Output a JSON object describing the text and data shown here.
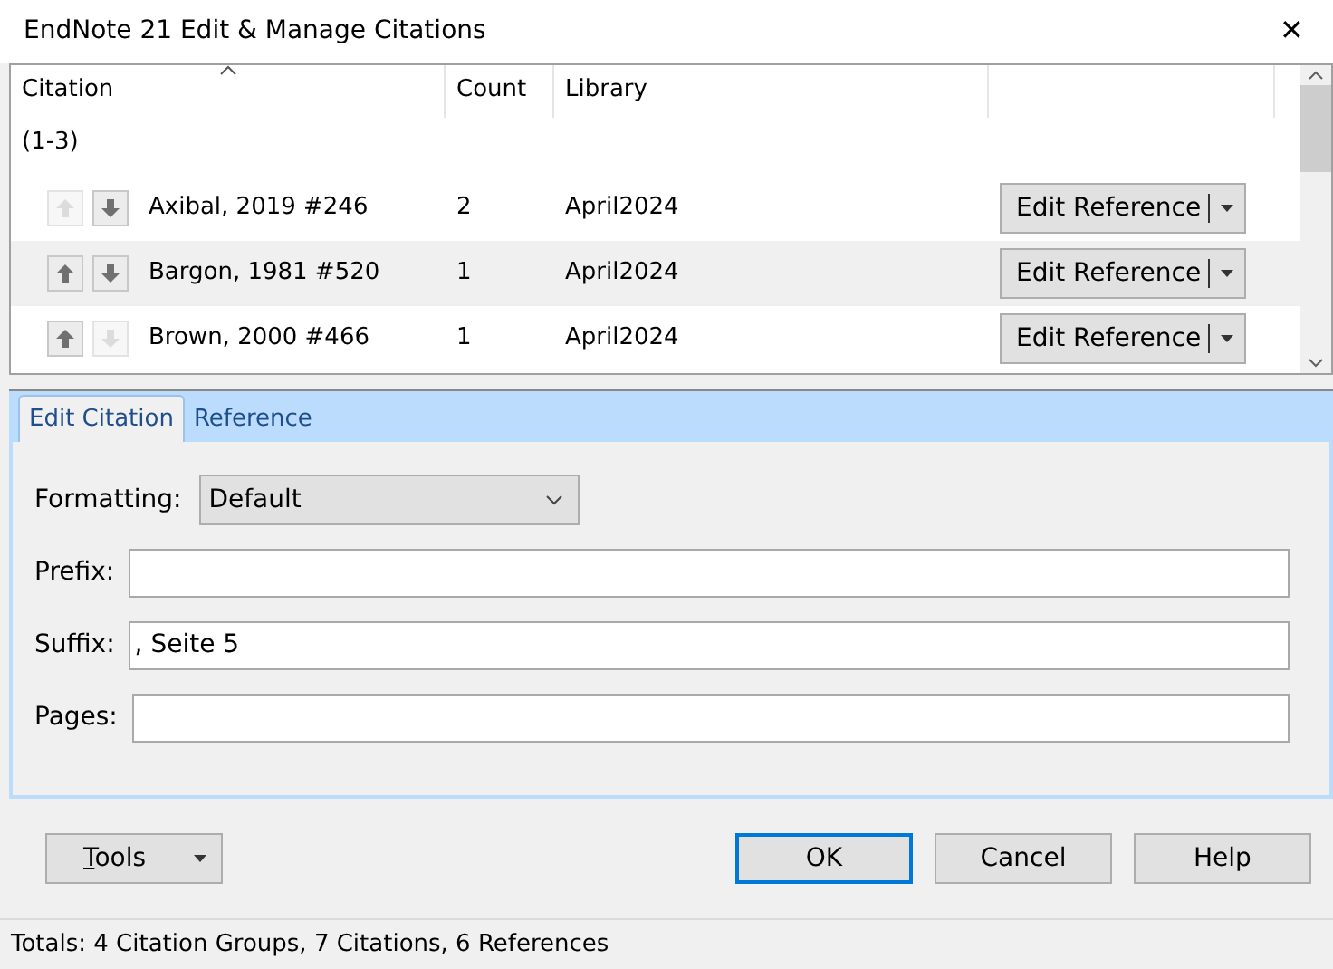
{
  "window": {
    "title": "EndNote 21 Edit & Manage Citations",
    "close": "✕"
  },
  "table": {
    "columns": [
      "Citation",
      "Count",
      "Library"
    ],
    "group": "(1-3)",
    "rows": [
      {
        "citation": "Axibal, 2019 #246",
        "count": "2",
        "library": "April2024",
        "button": "Edit Reference",
        "up_disabled": true,
        "down_disabled": false,
        "selected": false
      },
      {
        "citation": "Bargon, 1981 #520",
        "count": "1",
        "library": "April2024",
        "button": "Edit Reference",
        "up_disabled": false,
        "down_disabled": false,
        "selected": true
      },
      {
        "citation": "Brown, 2000 #466",
        "count": "1",
        "library": "April2024",
        "button": "Edit Reference",
        "up_disabled": false,
        "down_disabled": true,
        "selected": false
      }
    ]
  },
  "tabs": [
    {
      "label": "Edit Citation",
      "selected": true
    },
    {
      "label": "Reference",
      "selected": false
    }
  ],
  "form": {
    "formatting": {
      "label": "Formatting:",
      "value": "Default"
    },
    "fields": [
      {
        "label": "Prefix:"
      },
      {
        "label": "Suffix:",
        "value": ", Seite 5"
      },
      {
        "label": "Pages:"
      }
    ]
  },
  "tools": "Tools",
  "buttons": [
    {
      "label": "OK",
      "default": true
    },
    {
      "label": "Cancel",
      "default": false
    },
    {
      "label": "Help",
      "default": false
    }
  ],
  "status_bar": "Totals: 4 Citation Groups, 7 Citations, 6 References"
}
